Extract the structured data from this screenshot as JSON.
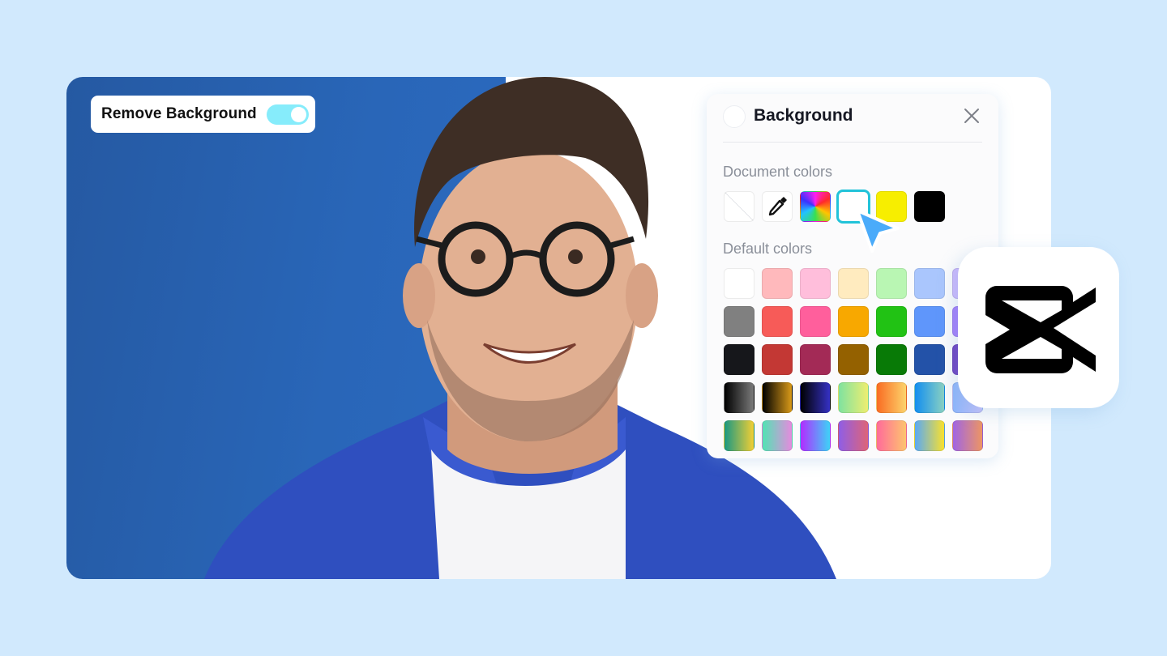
{
  "toggle": {
    "label": "Remove Background",
    "state": "on",
    "color": "#86ecfb"
  },
  "panel": {
    "title": "Background",
    "close_icon": "close-icon",
    "document_colors_label": "Document colors",
    "document_colors": [
      {
        "name": "no-color",
        "value": "none"
      },
      {
        "name": "eyedropper",
        "value": "eyedropper"
      },
      {
        "name": "color-wheel",
        "value": "conic-gradient"
      },
      {
        "name": "white",
        "value": "#ffffff",
        "selected": true
      },
      {
        "name": "yellow",
        "value": "#f7ee00"
      },
      {
        "name": "black",
        "value": "#000000"
      }
    ],
    "default_colors_label": "Default colors",
    "default_colors": [
      [
        "#ffffff",
        "#ffb9bc",
        "#ffbedb",
        "#ffebbf",
        "#b9f6b3",
        "#aac6fd",
        "#cdb8fd"
      ],
      [
        "#808080",
        "#f75b58",
        "#ff5f9c",
        "#f8a800",
        "#21c214",
        "#5f96fb",
        "#a47dfb"
      ],
      [
        "#16171b",
        "#c33834",
        "#a32a56",
        "#946100",
        "#087a06",
        "#2352a8",
        "#6d3ec0"
      ],
      [
        "linear-gradient(90deg,#000,#7b7b7b)",
        "linear-gradient(90deg,#000,#d99a19)",
        "linear-gradient(90deg,#000,#3531c4)",
        "linear-gradient(90deg,#7fe2a0,#eeee70)",
        "linear-gradient(90deg,#fa6c22,#fcd36c)",
        "linear-gradient(90deg,#128ef0,#8ad1c2)",
        "linear-gradient(90deg,#8db6fb,#c6c0fb)"
      ],
      [
        "linear-gradient(90deg,#1a9882,#f2cf34)",
        "linear-gradient(90deg,#52e3b4,#e58bde)",
        "linear-gradient(90deg,#b22cff,#3dd3f7)",
        "linear-gradient(90deg,#8f5ee6,#de6478)",
        "linear-gradient(90deg,#ff6b9a,#fdc46e)",
        "linear-gradient(90deg,#5aa9f4,#f9e12e)",
        "linear-gradient(90deg,#a065e4,#ee9563)"
      ]
    ]
  },
  "brand": {
    "logo": "capcut-logo"
  },
  "colors": {
    "page_bg": "#d1e9fd",
    "left_bg": "#2966b8",
    "accent": "#22c3d9",
    "cursor": "#4aabfa"
  }
}
